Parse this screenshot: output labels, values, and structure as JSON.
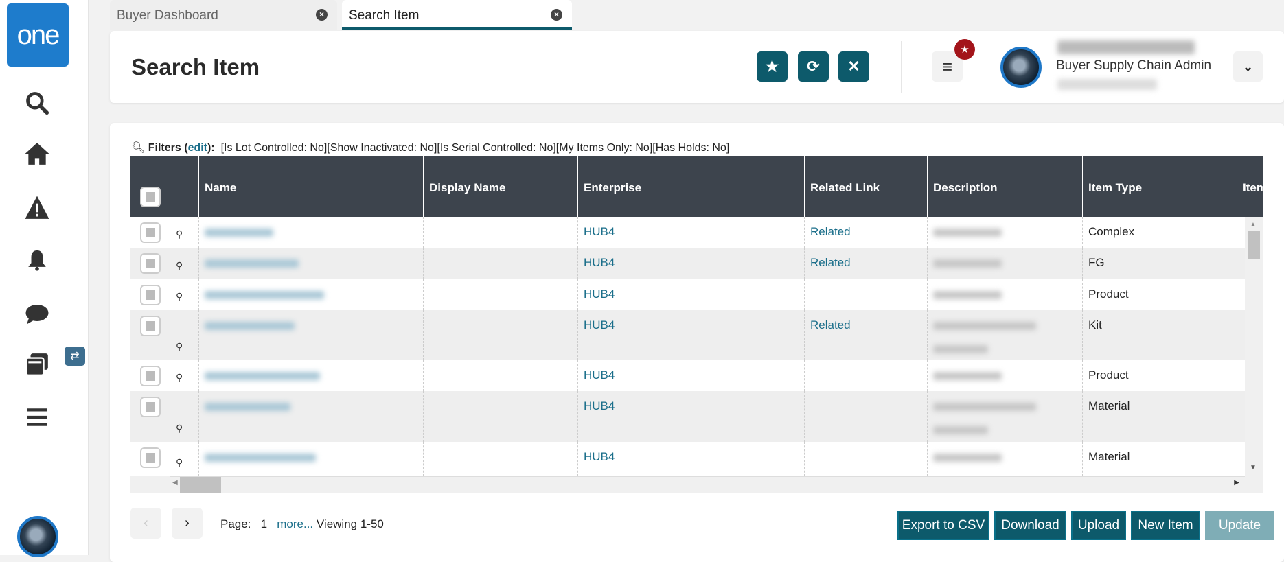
{
  "sidebar": {
    "logo": "one",
    "items": [
      "search",
      "home",
      "alerts",
      "notifications",
      "chat",
      "windows",
      "menu"
    ]
  },
  "tabs": [
    {
      "label": "Buyer Dashboard",
      "active": false
    },
    {
      "label": "Search Item",
      "active": true
    }
  ],
  "header": {
    "title": "Search Item",
    "user_role": "Buyer Supply Chain Admin"
  },
  "filters": {
    "label": "Filters",
    "edit": "edit",
    "text": "[Is Lot Controlled: No][Show Inactivated: No][Is Serial Controlled: No][My Items Only: No][Has Holds: No]"
  },
  "table": {
    "columns": [
      "Name",
      "Display Name",
      "Enterprise",
      "Related Link",
      "Description",
      "Item Type",
      "Item"
    ],
    "rows": [
      {
        "enterprise": "HUB4",
        "related": "Related",
        "item_type": "Complex"
      },
      {
        "enterprise": "HUB4",
        "related": "Related",
        "item_type": "FG"
      },
      {
        "enterprise": "HUB4",
        "related": "",
        "item_type": "Product"
      },
      {
        "enterprise": "HUB4",
        "related": "Related",
        "item_type": "Kit"
      },
      {
        "enterprise": "HUB4",
        "related": "",
        "item_type": "Product"
      },
      {
        "enterprise": "HUB4",
        "related": "",
        "item_type": "Material"
      },
      {
        "enterprise": "HUB4",
        "related": "",
        "item_type": "Material"
      }
    ]
  },
  "pagination": {
    "page_label": "Page:",
    "page": "1",
    "more": "more...",
    "viewing": "Viewing 1-50"
  },
  "buttons": {
    "export": "Export to CSV",
    "download": "Download",
    "upload": "Upload",
    "new_item": "New Item",
    "update": "Update"
  }
}
